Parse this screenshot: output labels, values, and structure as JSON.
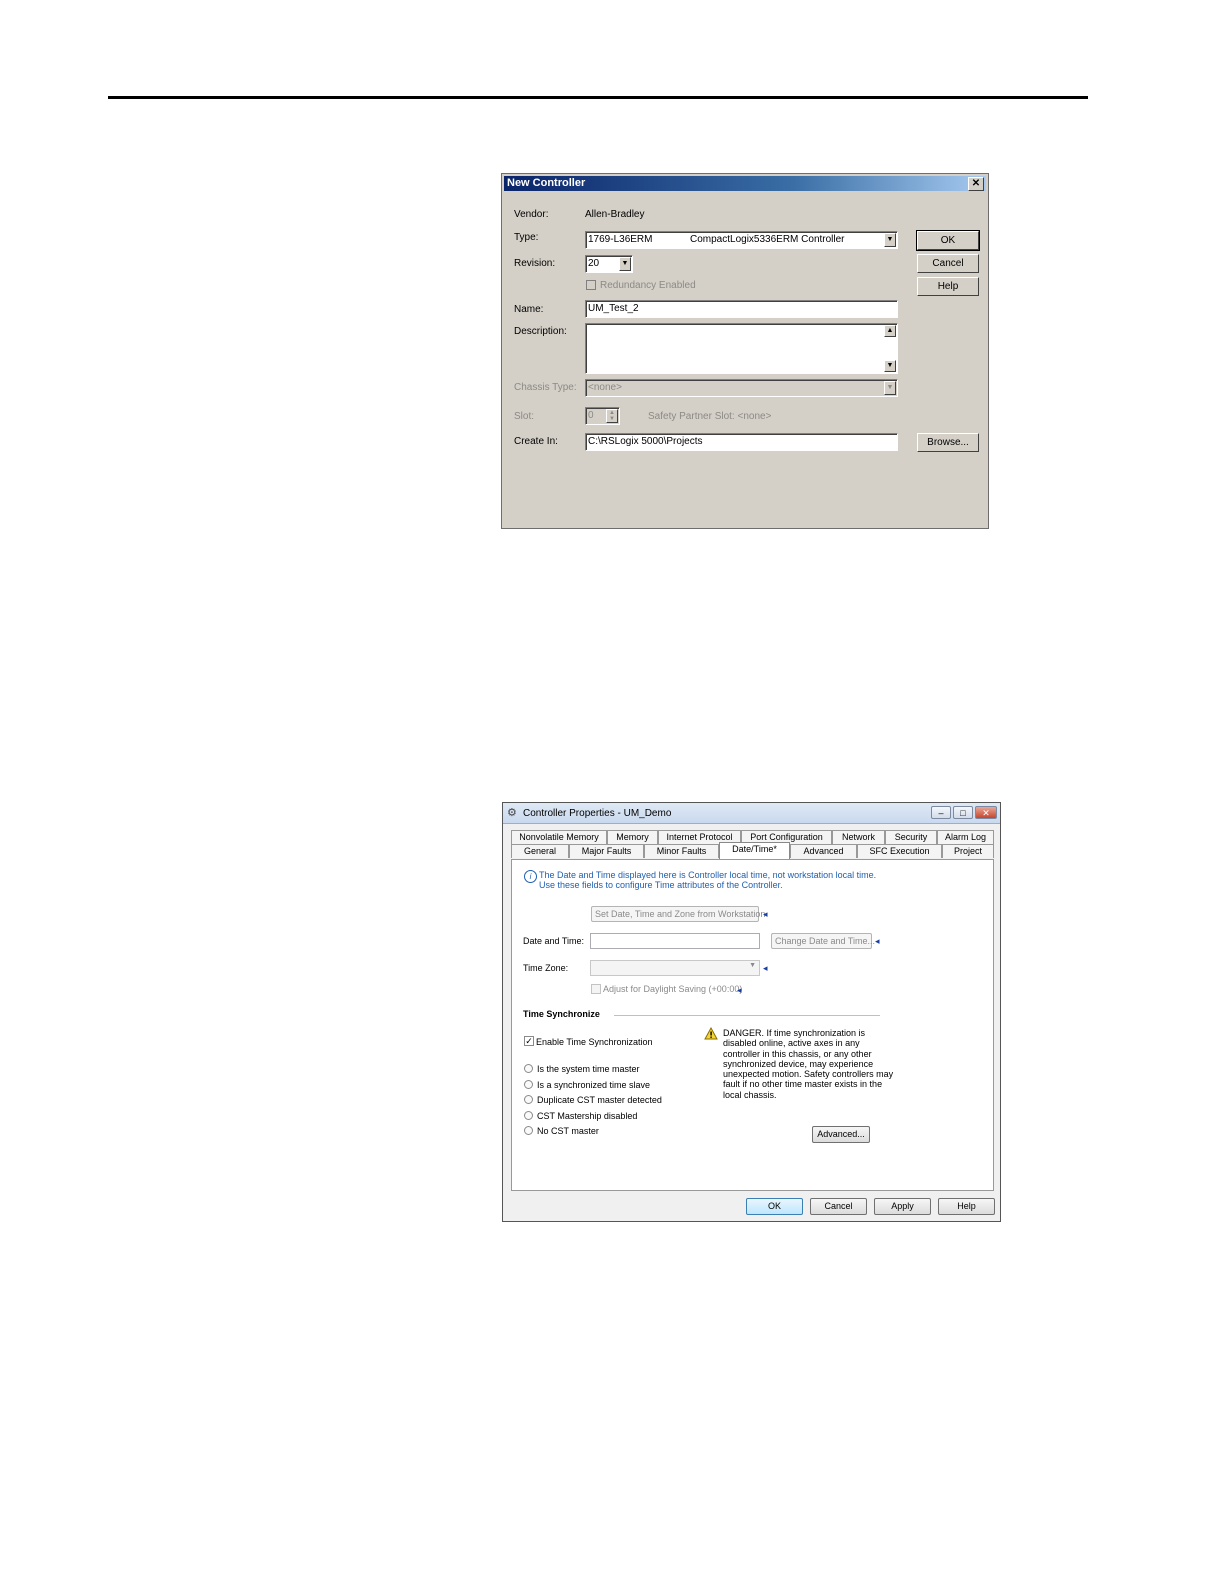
{
  "new_controller": {
    "title": "New Controller",
    "close_label": "✕",
    "vendor_label": "Vendor:",
    "vendor_value": "Allen-Bradley",
    "type_label": "Type:",
    "type_code": "1769-L36ERM",
    "type_desc": "CompactLogix5336ERM Controller",
    "revision_label": "Revision:",
    "revision_value": "20",
    "redundancy_label": "Redundancy Enabled",
    "name_label": "Name:",
    "name_value": "UM_Test_2",
    "description_label": "Description:",
    "chassis_label": "Chassis Type:",
    "chassis_value": "<none>",
    "slot_label": "Slot:",
    "slot_value": "0",
    "safety_partner": "Safety Partner Slot: <none>",
    "create_in_label": "Create In:",
    "create_in_value": "C:\\RSLogix 5000\\Projects",
    "ok_label": "OK",
    "cancel_label": "Cancel",
    "help_label": "Help",
    "browse_label": "Browse..."
  },
  "controller_properties": {
    "title": "Controller Properties - UM_Demo",
    "tabs_row1": [
      "Nonvolatile Memory",
      "Memory",
      "Internet Protocol",
      "Port Configuration",
      "Network",
      "Security",
      "Alarm Log"
    ],
    "tabs_row2": [
      "General",
      "Major Faults",
      "Minor Faults",
      "Date/Time*",
      "Advanced",
      "SFC Execution",
      "Project"
    ],
    "info_line1": "The Date and Time displayed here is Controller local time, not workstation local time.",
    "info_line2": "Use these fields to configure Time attributes of the Controller.",
    "set_from_workstation": "Set Date, Time and Zone from Workstation",
    "date_time_label": "Date and Time:",
    "change_date_time": "Change Date and Time...",
    "time_zone_label": "Time Zone:",
    "daylight_label": "Adjust for Daylight Saving (+00:00)",
    "time_sync_header": "Time Synchronize",
    "enable_sync_label": "Enable Time Synchronization",
    "radios": [
      "Is the system time master",
      "Is a synchronized time slave",
      "Duplicate CST master detected",
      "CST Mastership disabled",
      "No CST master"
    ],
    "danger_lines": [
      "DANGER. If time synchronization is",
      "disabled online, active axes in any",
      "controller in this chassis, or any other",
      "synchronized device, may experience",
      "unexpected motion.  Safety controllers may",
      "fault if no other time master exists in the",
      "local chassis."
    ],
    "advanced_btn": "Advanced...",
    "ok": "OK",
    "cancel": "Cancel",
    "apply": "Apply",
    "help": "Help"
  }
}
